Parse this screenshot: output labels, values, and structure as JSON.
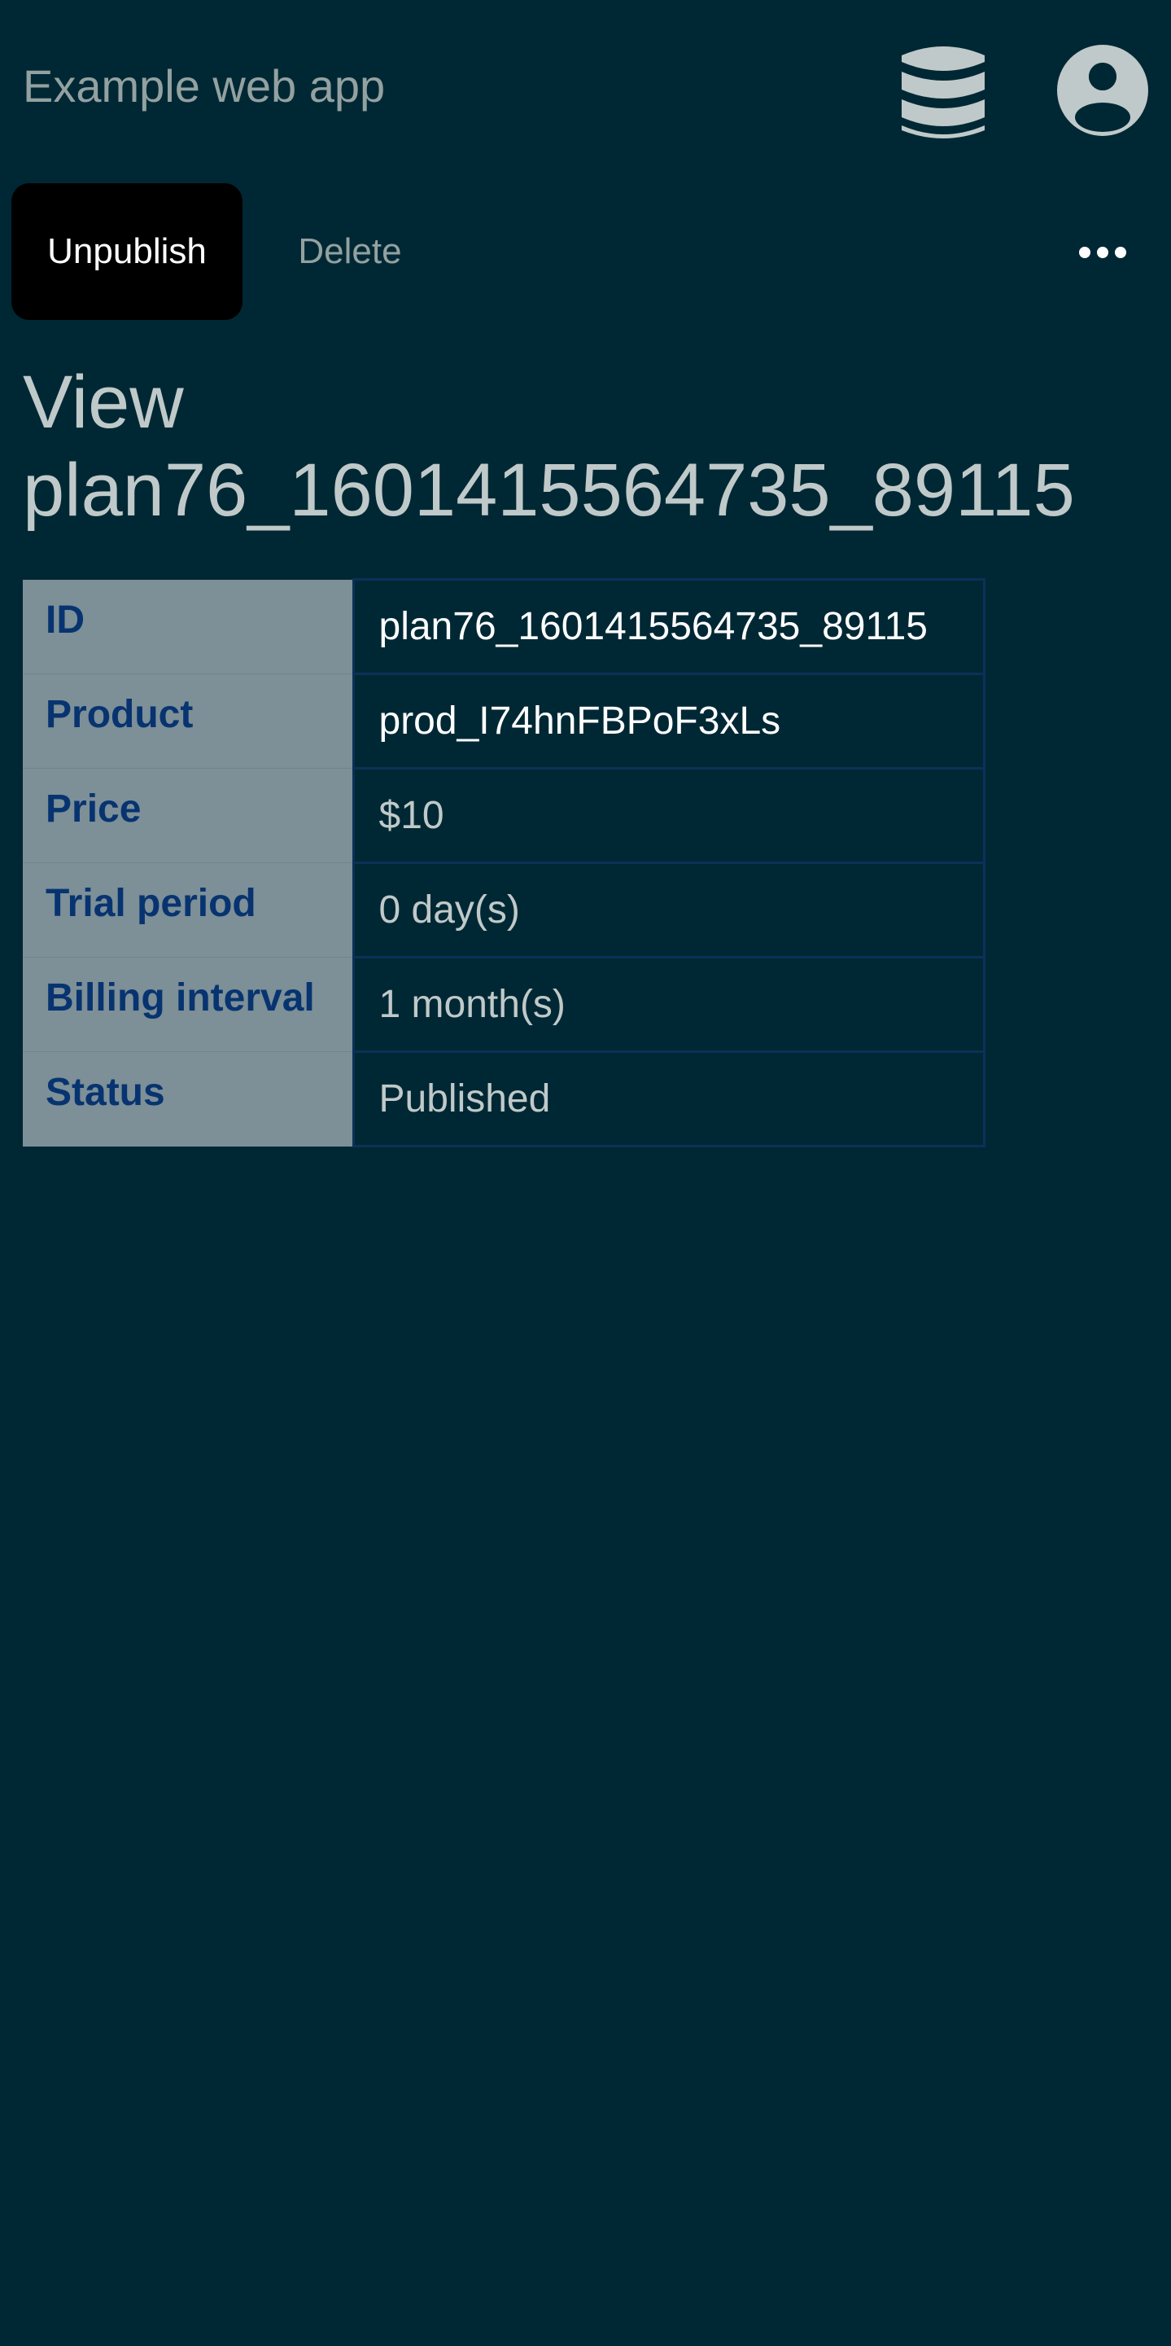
{
  "header": {
    "app_title": "Example web app",
    "database_icon": "database-icon",
    "account_icon": "account-circle-icon"
  },
  "toolbar": {
    "unpublish_label": "Unpublish",
    "delete_label": "Delete",
    "more_icon": "more-horizontal-icon"
  },
  "page": {
    "title": "View plan76_1601415564735_89115"
  },
  "details": {
    "rows": [
      {
        "label": "ID",
        "value": "plan76_1601415564735_89115"
      },
      {
        "label": "Product",
        "value": "prod_I74hnFBPoF3xLs"
      },
      {
        "label": "Price",
        "value": "$10"
      },
      {
        "label": "Trial period",
        "value": "0 day(s)"
      },
      {
        "label": "Billing interval",
        "value": "1 month(s)"
      },
      {
        "label": "Status",
        "value": "Published"
      }
    ]
  },
  "colors": {
    "background": "#002834",
    "header_text": "#93a1a1",
    "icon_fill": "#c0c9c9",
    "label_cell_bg": "#7d8f97",
    "label_text": "#073470",
    "cell_border": "#0a3158",
    "primary_button_bg": "#000000"
  }
}
